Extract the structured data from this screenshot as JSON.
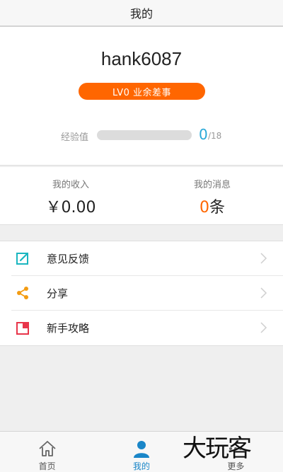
{
  "header": {
    "title": "我的"
  },
  "profile": {
    "username": "hank6087",
    "level_badge": "LV0 业余差事",
    "exp_label": "经验值",
    "exp_value": "0",
    "exp_max": "/18",
    "exp_progress": 0
  },
  "stats": {
    "income_label": "我的收入",
    "income_value": "￥0.00",
    "messages_label": "我的消息",
    "messages_count": "0",
    "messages_unit": "条"
  },
  "menu": {
    "items": [
      {
        "label": "意见反馈",
        "icon": "edit-icon",
        "color": "#1bb6c0"
      },
      {
        "label": "分享",
        "icon": "share-icon",
        "color": "#f39c12"
      },
      {
        "label": "新手攻略",
        "icon": "bookmark-icon",
        "color": "#e8354a"
      }
    ]
  },
  "tabs": [
    {
      "label": "首页",
      "icon": "home-icon"
    },
    {
      "label": "我的",
      "icon": "user-icon",
      "active": true
    },
    {
      "label": "更多",
      "icon": "more-icon"
    }
  ],
  "watermark": "大玩客",
  "colors": {
    "accent_orange": "#ff6600",
    "accent_blue": "#29a8d8",
    "tab_active": "#1a86c8"
  }
}
